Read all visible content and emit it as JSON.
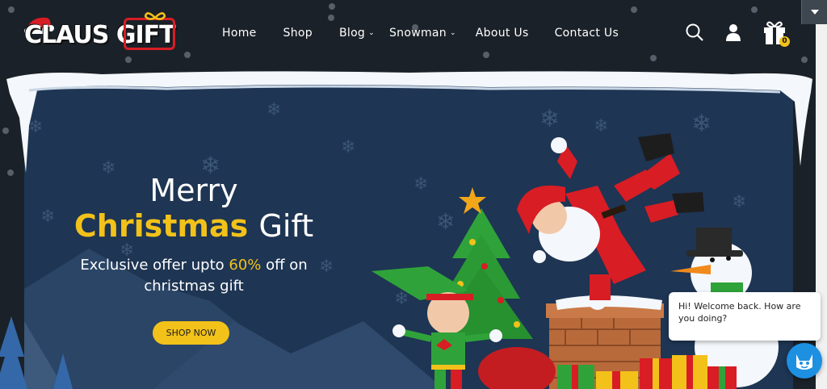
{
  "logo": {
    "text_part1": "CLAUS",
    "text_part2": "GIFT"
  },
  "nav": {
    "items": [
      {
        "label": "Home",
        "has_dropdown": false
      },
      {
        "label": "Shop",
        "has_dropdown": false
      },
      {
        "label": "Blog",
        "has_dropdown": true
      },
      {
        "label": "Snowman",
        "has_dropdown": true
      },
      {
        "label": "About Us",
        "has_dropdown": false
      },
      {
        "label": "Contact Us",
        "has_dropdown": false
      }
    ]
  },
  "header_icons": {
    "search": "search-icon",
    "account": "user-icon",
    "cart": "gift-cart-icon",
    "cart_count": "0"
  },
  "hero": {
    "line1": "Merry",
    "line2_gold": "Christmas",
    "line2_white": "Gift",
    "subtitle_pre": "Exclusive offer upto ",
    "subtitle_highlight": "60%",
    "subtitle_post": " off on",
    "subtitle_line2": "christmas gift",
    "cta": "SHOP NOW"
  },
  "chat": {
    "message": "Hi! Welcome back. How are you doing?"
  },
  "colors": {
    "page_bg": "#1b2128",
    "hero_bg": "#1e3553",
    "accent_gold": "#f2c21a",
    "brand_red": "#d81d24",
    "chat_blue": "#1d90e2"
  }
}
